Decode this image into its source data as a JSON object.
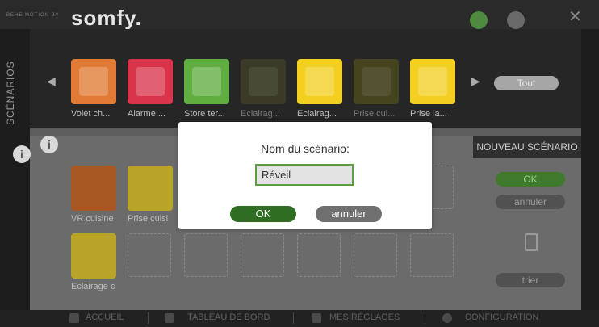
{
  "app": {
    "brand_tagline": "BEHE MOTION BY",
    "brand_name": "somfy."
  },
  "sidebar": {
    "label": "SCÉNARIOS"
  },
  "devices": [
    {
      "label": "Volet ch...",
      "color": "#e07a34",
      "icon": "shutter-icon"
    },
    {
      "label": "Alarme ...",
      "color": "#d9344a",
      "icon": "alarm-icon"
    },
    {
      "label": "Store ter...",
      "color": "#5fae3f",
      "icon": "awning-icon"
    },
    {
      "label": "Eclairag...",
      "color": "#3a3a26",
      "icon": "light-bulb-icon",
      "dim": true
    },
    {
      "label": "Eclairag...",
      "color": "#f3d020",
      "icon": "light-bulb-icon"
    },
    {
      "label": "Prise cui...",
      "color": "#46441f",
      "icon": "plug-icon",
      "dim": true
    },
    {
      "label": "Prise la...",
      "color": "#f3d020",
      "icon": "plug-icon"
    }
  ],
  "carousel": {
    "tout_label": "Tout"
  },
  "scenario_panel": {
    "title": "NOUVEAU SCÉNARIO",
    "ok_label": "OK",
    "cancel_label": "annuler",
    "sort_label": "trier"
  },
  "scenario_items": [
    {
      "label": "VR cuisine",
      "color": "#a65722",
      "icon": "shutter-icon"
    },
    {
      "label": "Prise cuisi",
      "color": "#b9a42a",
      "icon": "plug-icon"
    },
    {
      "label": "Eclairage c",
      "color": "#b9a42a",
      "icon": "light-bulb-icon"
    }
  ],
  "bottom_nav": [
    {
      "label": "ACCUEIL",
      "icon": "home-icon"
    },
    {
      "label": "TABLEAU DE BORD",
      "icon": "dashboard-icon"
    },
    {
      "label": "MES RÉGLAGES",
      "icon": "user-icon"
    },
    {
      "label": "CONFIGURATION",
      "icon": "gear-icon"
    }
  ],
  "modal": {
    "title": "Nom du scénario:",
    "input_value": "Réveil",
    "ok_label": "OK",
    "cancel_label": "annuler"
  },
  "colors": {
    "accent_green": "#3f7a2c",
    "modal_ok": "#2f6d23",
    "input_border": "#5d9e45"
  }
}
